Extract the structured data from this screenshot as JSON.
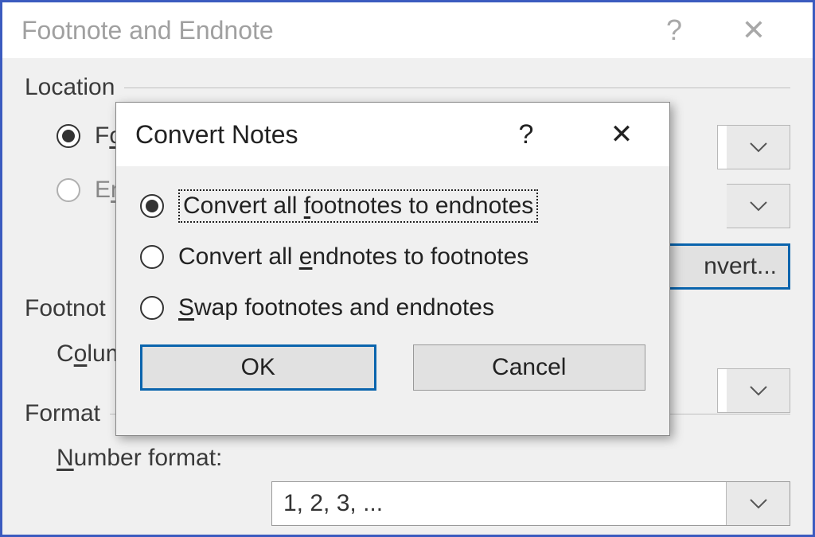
{
  "parent": {
    "title": "Footnote and Endnote",
    "section_location": "Location",
    "radio_footnotes_prefix": "F",
    "radio_footnotes_accel": "o",
    "radio_endnotes_prefix": "E",
    "radio_endnotes_accel": "n",
    "convert_button": "nvert...",
    "section_footnote_layout": "Footnot",
    "columns_prefix": "C",
    "columns_accel": "o",
    "columns_suffix": "lum",
    "section_format": "Format",
    "number_format_accel": "N",
    "number_format_rest": "umber format:",
    "number_format_value": "1, 2, 3, ..."
  },
  "child": {
    "title": "Convert Notes",
    "opt1_pre": "Convert all ",
    "opt1_accel": "f",
    "opt1_post": "ootnotes to endnotes",
    "opt2_pre": "Convert all ",
    "opt2_accel": "e",
    "opt2_post": "ndnotes to footnotes",
    "opt3_accel": "S",
    "opt3_post": "wap footnotes and endnotes",
    "ok": "OK",
    "cancel": "Cancel"
  }
}
